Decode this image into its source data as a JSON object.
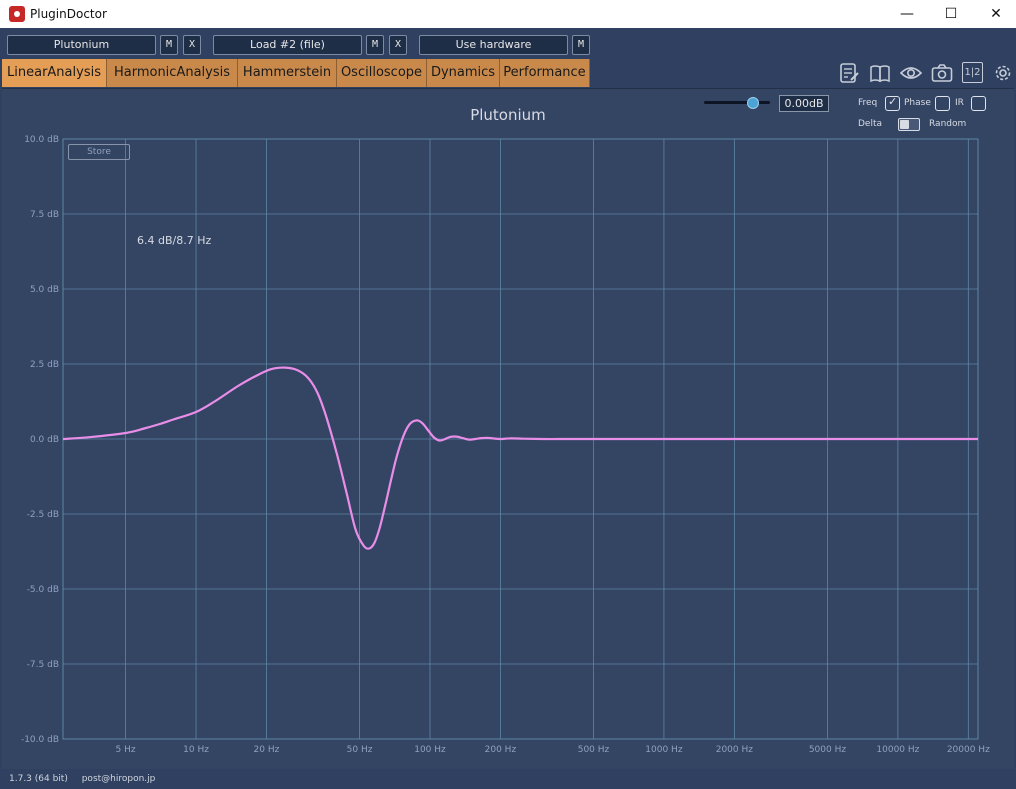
{
  "window": {
    "title": "PluginDoctor",
    "minimize": "—",
    "maximize": "☐",
    "close": "✕"
  },
  "toolbar": {
    "plugin_name": "Plutonium",
    "plugin_m": "M",
    "plugin_x": "X",
    "load_label": "Load #2 (file)",
    "load_m": "M",
    "load_x": "X",
    "hardware_label": "Use hardware",
    "hardware_m": "M"
  },
  "tabs": [
    {
      "label": "LinearAnalysis",
      "active": true
    },
    {
      "label": "HarmonicAnalysis",
      "active": false
    },
    {
      "label": "Hammerstein",
      "active": false
    },
    {
      "label": "Oscilloscope",
      "active": false
    },
    {
      "label": "Dynamics",
      "active": false
    },
    {
      "label": "Performance",
      "active": false
    }
  ],
  "toolbar_icons": [
    "notes-icon",
    "manual-book-icon",
    "eye-icon",
    "camera-icon",
    "split-1-2-icon",
    "settings-gear-icon"
  ],
  "split_icon_text": "1|2",
  "plot": {
    "title": "Plutonium",
    "gain_value": "0.00dB",
    "gain_slider_level": 0.72,
    "options": {
      "freq_label": "Freq",
      "freq_checked": true,
      "phase_label": "Phase",
      "phase_checked": false,
      "ir_label": "IR",
      "ir_checked": false,
      "delta_label": "Delta",
      "delta_on": false,
      "random_label": "Random"
    },
    "store_label": "Store",
    "readout": "6.4 dB/8.7 Hz",
    "line_color": "#e98ee8",
    "grid_color": "#5e86a6"
  },
  "chart_data": {
    "type": "line",
    "title": "Plutonium",
    "xlabel": "",
    "ylabel": "",
    "x_scale": "log",
    "xlim": [
      2.7,
      22000
    ],
    "ylim": [
      -10,
      10
    ],
    "grid": true,
    "x_ticks": [
      5,
      10,
      20,
      50,
      100,
      200,
      500,
      1000,
      2000,
      5000,
      10000,
      20000
    ],
    "x_tick_labels": [
      "5 Hz",
      "10 Hz",
      "20 Hz",
      "50 Hz",
      "100 Hz",
      "200 Hz",
      "500 Hz",
      "1000 Hz",
      "2000 Hz",
      "5000 Hz",
      "10000 Hz",
      "20000 Hz"
    ],
    "y_ticks": [
      10,
      7.5,
      5,
      2.5,
      0,
      -2.5,
      -5,
      -7.5,
      -10
    ],
    "y_tick_labels": [
      "10.0 dB",
      "7.5 dB",
      "5.0 dB",
      "2.5 dB",
      "0.0 dB",
      "-2.5 dB",
      "-5.0 dB",
      "-7.5 dB",
      "-10.0 dB"
    ],
    "series": [
      {
        "color": "#e98ee8",
        "x": [
          2.7,
          3.5,
          5,
          6,
          7,
          8,
          10,
          12,
          15,
          18,
          21,
          24,
          27,
          30,
          33,
          36,
          40,
          44,
          48,
          52,
          55,
          58,
          61,
          64,
          68,
          72,
          77,
          82,
          88,
          93,
          98,
          104,
          110,
          116,
          122,
          130,
          138,
          147,
          156,
          166,
          176,
          186,
          200,
          220,
          250,
          300,
          400,
          600,
          1000,
          3000,
          10000,
          22000
        ],
        "y": [
          0.0,
          0.06,
          0.2,
          0.35,
          0.5,
          0.65,
          0.9,
          1.25,
          1.75,
          2.1,
          2.33,
          2.38,
          2.3,
          2.05,
          1.55,
          0.75,
          -0.5,
          -1.8,
          -3.0,
          -3.55,
          -3.65,
          -3.45,
          -2.95,
          -2.3,
          -1.4,
          -0.6,
          0.1,
          0.5,
          0.62,
          0.52,
          0.3,
          0.05,
          -0.05,
          0.0,
          0.07,
          0.08,
          0.03,
          -0.02,
          0.0,
          0.03,
          0.04,
          0.02,
          0.0,
          0.02,
          0.01,
          0.0,
          0.0,
          0.0,
          0.0,
          0.0,
          0.0,
          0.0
        ]
      }
    ]
  },
  "footer": {
    "version": "1.7.3 (64 bit)",
    "contact": "post@hiropon.jp"
  }
}
